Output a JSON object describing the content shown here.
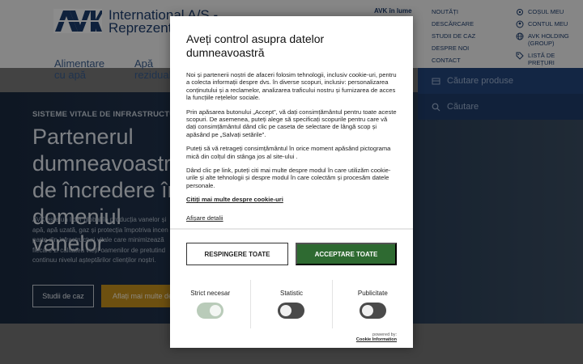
{
  "header": {
    "brand_line1": "International A/S -",
    "brand_line2": "Reprezentanta",
    "world_link": "AVK în lume",
    "utility_links": [
      "NOUTĂȚI",
      "DESCĂRCARE",
      "STUDII DE CAZ",
      "DESPRE NOI",
      "CONTACT"
    ],
    "account_links": [
      {
        "label": "COȘUL MEU",
        "icon": "gear-icon"
      },
      {
        "label": "CONTUL MEU",
        "icon": "user-icon"
      },
      {
        "label": "AVK HOLDING (GROUP)",
        "icon": "globe-icon"
      },
      {
        "label": "LISTĂ DE PREȚURI",
        "icon": "tag-icon"
      }
    ],
    "nav": [
      {
        "label": "Alimentare cu apă"
      },
      {
        "label": "Apă reziduală"
      }
    ],
    "search_product_placeholder": "Căutare produse",
    "search_placeholder": "Căutare"
  },
  "hero": {
    "eyebrow": "SISTEME VITALE DE INFRASTRUCTURĂ",
    "title": "Partenerul dumneavoastră de încredere în domeniul vanelor",
    "text": "AVK este un lider global în producția vanelor și\napă, apă uzată, gaz și protecția împotriva incen\nparte din infrastructuri vitale care minimizează\nfiecare zi calitatea vieții oamenilor de pretutind\ncontinuu nivelul așteptărilor clienților noștri.",
    "btn_case": "Studii de caz",
    "btn_more": "Aflați mai multe despre"
  },
  "cookie_dialog": {
    "title": "Aveți control asupra datelor dumneavoastră",
    "paragraphs": [
      "Noi și partenerii noștri de afaceri folosim tehnologii, inclusiv cookie-uri, pentru a colecta informații despre dvs. în diverse scopuri, inclusiv: personalizarea conținutului și a reclamelor, analizarea traficului nostru și furnizarea de acces la funcțiile rețelelor sociale.",
      "Prin apăsarea butonului „Accept”, vă dați consimțământul pentru toate aceste scopuri. De asemenea, puteți alege să specificați scopurile pentru care vă dați consimțământul dând clic pe caseta de selectare de lângă scop și apăsând pe „Salvați setările”.",
      "Puteți să vă retrageți consimțământul în orice moment apăsând pictograma mică din colțul din stânga jos al site-ului .",
      "Dând clic pe link, puteți citi mai multe despre modul în care utilizăm cookie-urile și alte tehnologii și despre modul în care colectăm și procesăm datele personale."
    ],
    "read_more_link": "Citiți mai multe despre cookie-uri",
    "details_link": "Afișare detalii",
    "reject_label": "RESPINGERE TOATE",
    "accept_label": "ACCEPTARE TOATE",
    "categories": [
      {
        "label": "Strict necesar",
        "enabled": true
      },
      {
        "label": "Statistic",
        "enabled": false
      },
      {
        "label": "Publicitate",
        "enabled": false
      }
    ],
    "powered_by": "powered by:",
    "powered_link": "Cookie Information"
  },
  "colors": {
    "accept_green": "#2e6a31",
    "brand_blue": "#1d3d6e",
    "hero_button_orange": "#c7921e"
  }
}
